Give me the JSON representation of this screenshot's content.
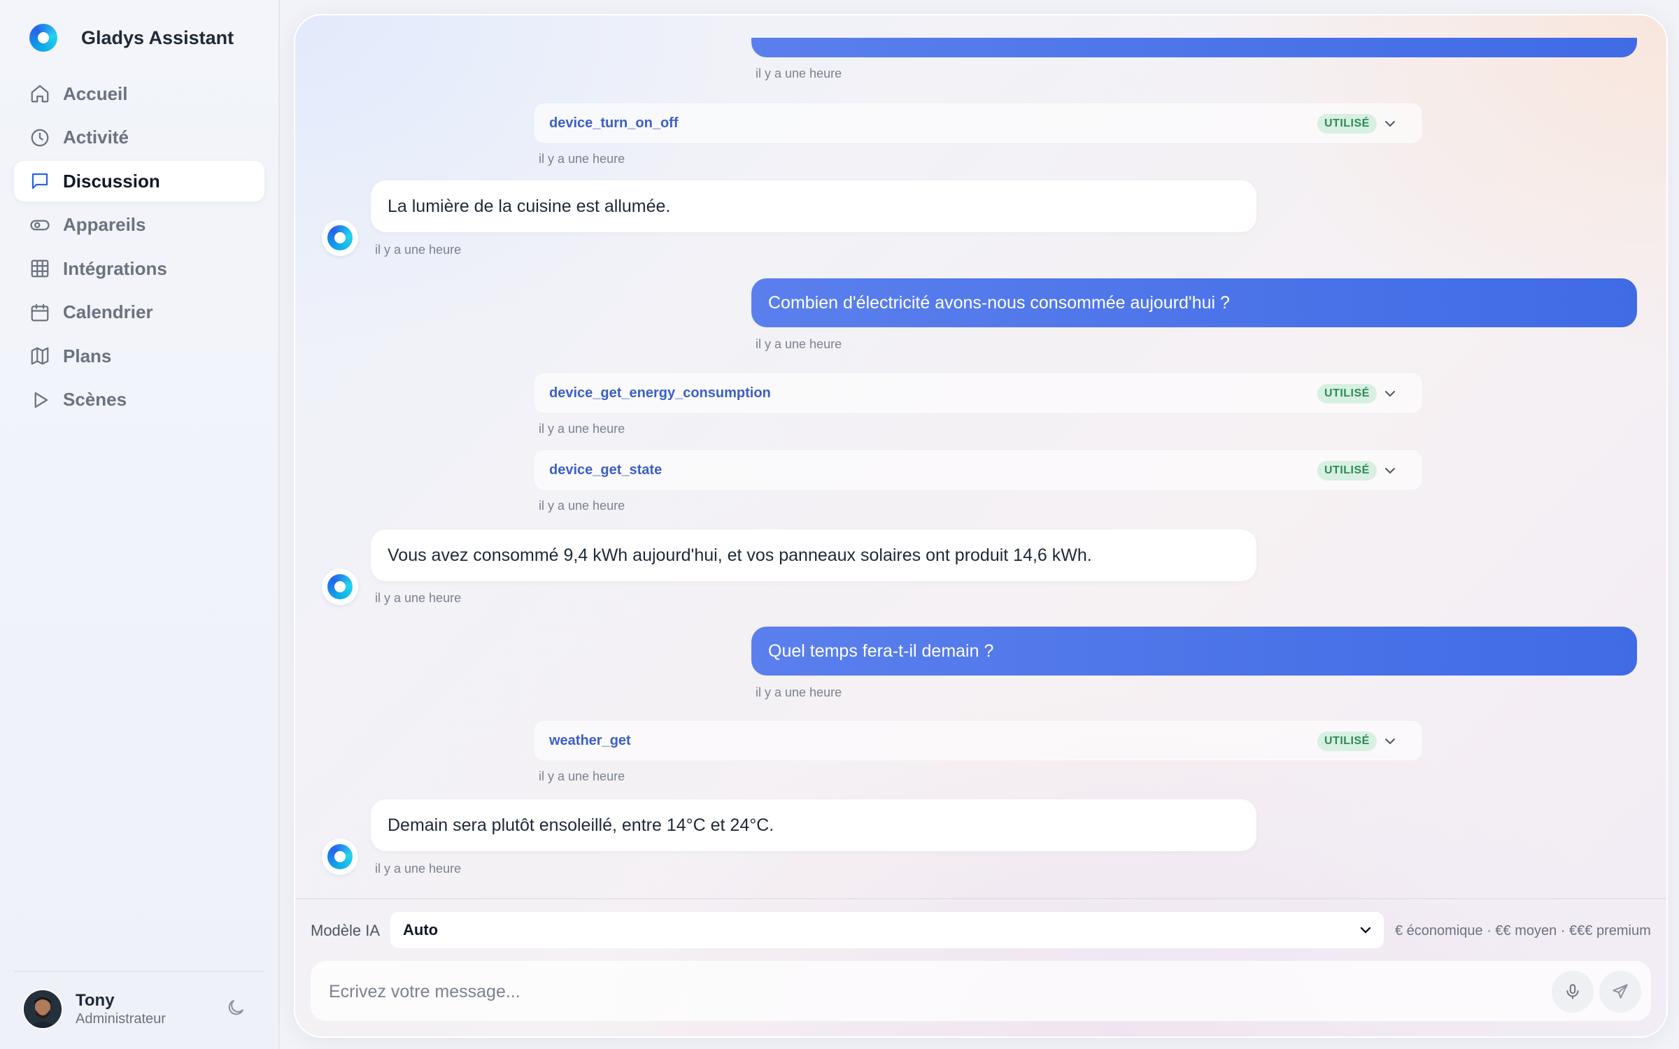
{
  "app": {
    "title": "Gladys Assistant"
  },
  "sidebar": {
    "items": [
      {
        "label": "Accueil",
        "icon": "home-icon"
      },
      {
        "label": "Activité",
        "icon": "clock-icon"
      },
      {
        "label": "Discussion",
        "icon": "chat-icon",
        "active": true
      },
      {
        "label": "Appareils",
        "icon": "toggle-icon"
      },
      {
        "label": "Intégrations",
        "icon": "grid-icon"
      },
      {
        "label": "Calendrier",
        "icon": "calendar-icon"
      },
      {
        "label": "Plans",
        "icon": "map-icon"
      },
      {
        "label": "Scènes",
        "icon": "play-icon"
      }
    ]
  },
  "user": {
    "name": "Tony",
    "role": "Administrateur"
  },
  "chat": {
    "timestamp": "il y a une heure",
    "tool_status": "UTILISÉ",
    "tools": [
      "device_turn_on_off",
      "device_get_energy_consumption",
      "device_get_state",
      "weather_get"
    ],
    "bot_messages": [
      "La lumière de la cuisine est allumée.",
      "Vous avez consommé 9,4 kWh aujourd'hui, et vos panneaux solaires ont produit 14,6 kWh.",
      "Demain sera plutôt ensoleillé, entre 14°C et 24°C."
    ],
    "user_messages": [
      "Combien d'électricité avons-nous consommée aujourd'hui ?",
      "Quel temps fera-t-il demain ?"
    ]
  },
  "composer": {
    "model_label": "Modèle IA",
    "model_value": "Auto",
    "price_hint": "€ économique · €€ moyen · €€€ premium",
    "placeholder": "Ecrivez votre message..."
  },
  "colors": {
    "accent": "#4a72e8",
    "badge_bg": "#d7f0e1",
    "badge_text": "#2f8a57"
  }
}
